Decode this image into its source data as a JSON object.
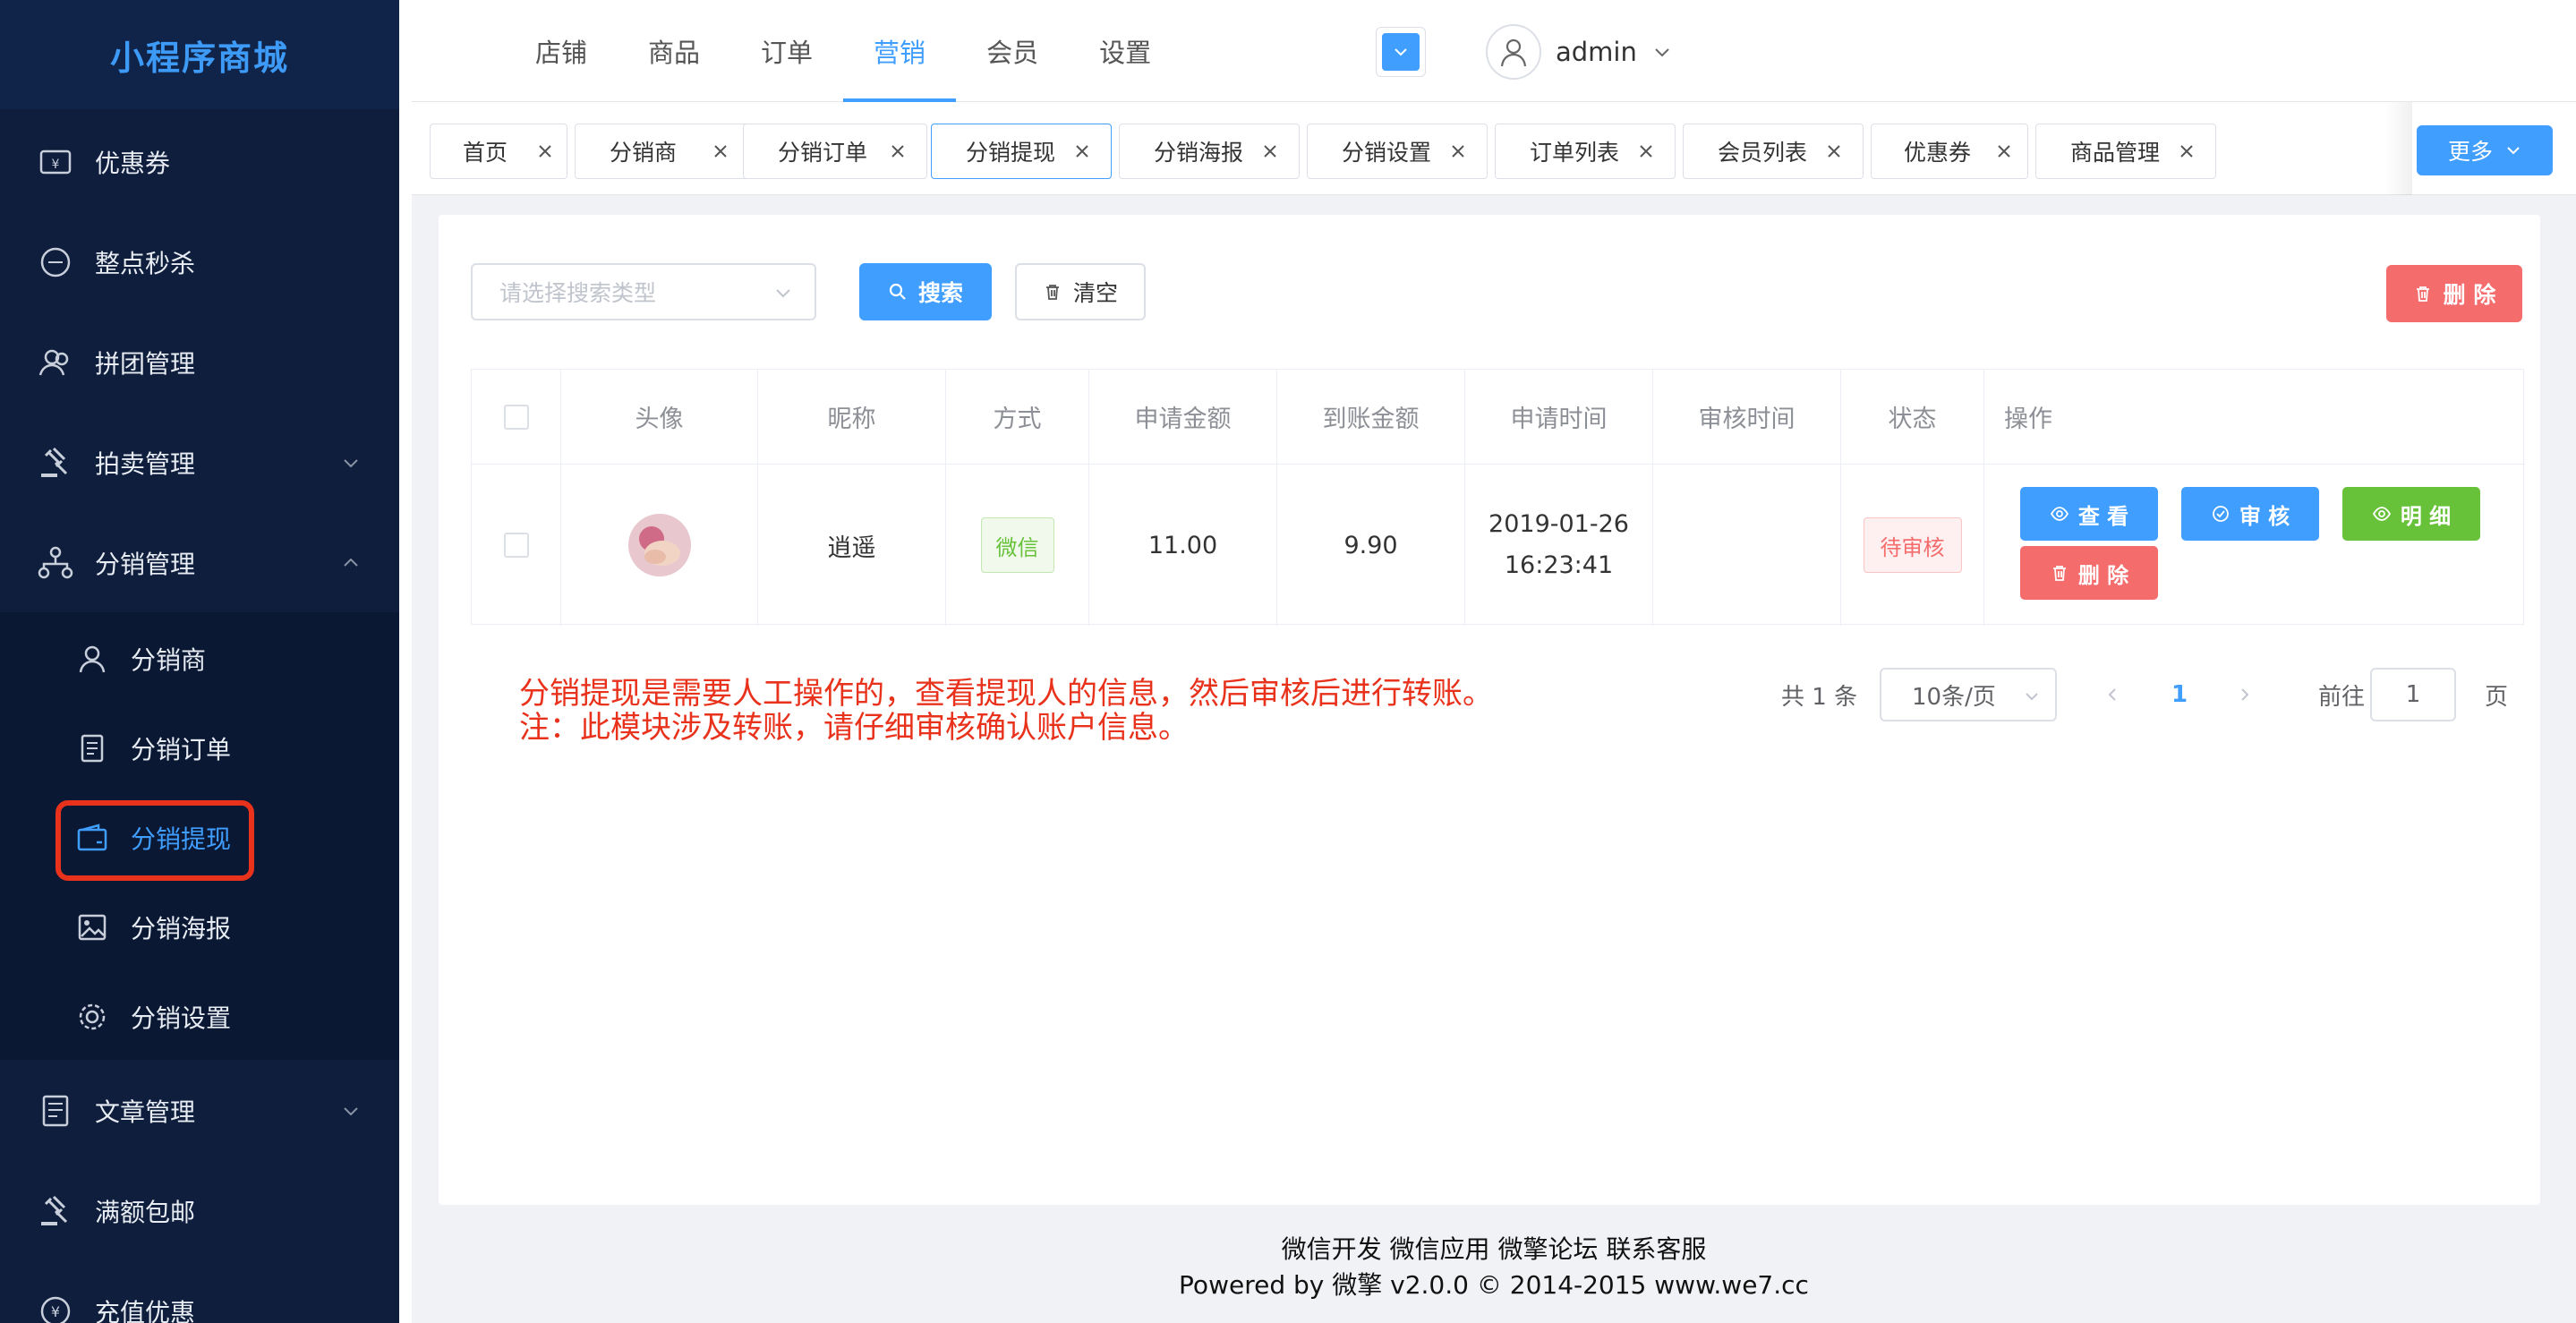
{
  "app": {
    "title": "小程序商城"
  },
  "sidebar": {
    "items": [
      {
        "label": "优惠券",
        "icon": "coupon-icon"
      },
      {
        "label": "整点秒杀",
        "icon": "flash-sale-icon"
      },
      {
        "label": "拼团管理",
        "icon": "group-buy-icon"
      },
      {
        "label": "拍卖管理",
        "icon": "auction-icon"
      },
      {
        "label": "分销管理",
        "icon": "distribution-icon"
      },
      {
        "label": "文章管理",
        "icon": "article-icon"
      },
      {
        "label": "满额包邮",
        "icon": "free-shipping-icon"
      },
      {
        "label": "充值优惠",
        "icon": "recharge-icon"
      }
    ],
    "submenu": [
      {
        "label": "分销商",
        "icon": "user-icon"
      },
      {
        "label": "分销订单",
        "icon": "order-icon"
      },
      {
        "label": "分销提现",
        "icon": "wallet-icon"
      },
      {
        "label": "分销海报",
        "icon": "image-icon"
      },
      {
        "label": "分销设置",
        "icon": "gear-icon"
      }
    ]
  },
  "topnav": {
    "tabs": [
      "店铺",
      "商品",
      "订单",
      "营销",
      "会员",
      "设置"
    ],
    "active": "营销",
    "user": "admin"
  },
  "tags": {
    "items": [
      "首页",
      "分销商",
      "分销订单",
      "分销提现",
      "分销海报",
      "分销设置",
      "订单列表",
      "会员列表",
      "优惠券",
      "商品管理"
    ],
    "active": "分销提现",
    "more_label": "更多"
  },
  "toolbar": {
    "search_placeholder": "请选择搜索类型",
    "search_label": "搜索",
    "clear_label": "清空",
    "delete_label": "删 除"
  },
  "table": {
    "headers": [
      "头像",
      "昵称",
      "方式",
      "申请金额",
      "到账金额",
      "申请时间",
      "审核时间",
      "状态",
      "操作"
    ],
    "rows": [
      {
        "nickname": "逍遥",
        "method": "微信",
        "apply_amount": "11.00",
        "received_amount": "9.90",
        "apply_date": "2019-01-26",
        "apply_time": "16:23:41",
        "review_time": "",
        "status": "待审核",
        "actions": {
          "view": "查 看",
          "review": "审 核",
          "detail": "明 细",
          "delete": "删 除"
        }
      }
    ]
  },
  "note": {
    "line1": "分销提现是需要人工操作的，查看提现人的信息，然后审核后进行转账。",
    "line2": "注：此模块涉及转账，请仔细审核确认账户信息。"
  },
  "pagination": {
    "total": "共 1 条",
    "page_size": "10条/页",
    "current": "1",
    "goto_label": "前往",
    "goto_value": "1",
    "page_suffix": "页"
  },
  "footer": {
    "links": "微信开发 微信应用 微擎论坛 联系客服",
    "powered": "Powered by 微擎 v2.0.0 © 2014-2015 www.we7.cc"
  },
  "colors": {
    "primary": "#409eff",
    "danger": "#f56c6c",
    "success": "#67c23a",
    "sidebar": "#0e1e3c",
    "note": "#e8321c"
  }
}
